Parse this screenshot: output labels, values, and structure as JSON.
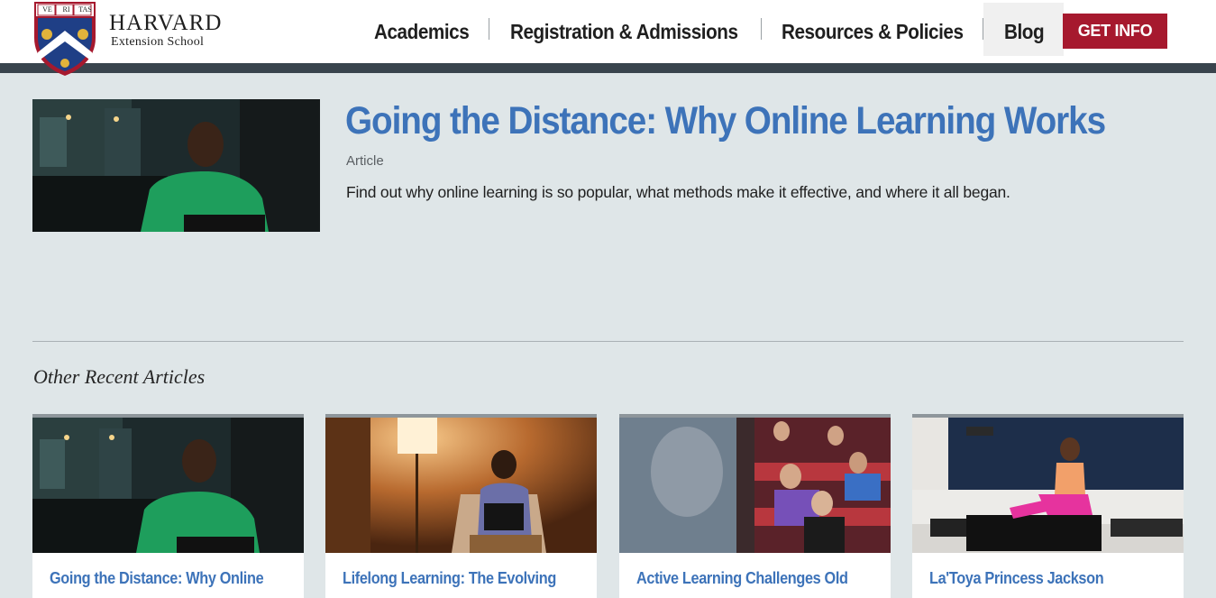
{
  "header": {
    "logo_line1": "HARVARD",
    "logo_line2": "Extension School",
    "logo_motto": [
      "VE",
      "RI",
      "TAS"
    ],
    "nav": [
      {
        "label": "Academics"
      },
      {
        "label": "Registration & Admissions"
      },
      {
        "label": "Resources & Policies"
      },
      {
        "label": "Blog"
      }
    ],
    "cta_label": "GET INFO",
    "colors": {
      "crimson": "#a6192e",
      "band": "#39444d",
      "link_blue": "#3d73b9"
    }
  },
  "featured": {
    "title": "Going the Distance: Why Online Learning Works",
    "type": "Article",
    "description": "Find out why online learning is so popular, what methods make it effective, and where it all began.",
    "image": "man-green-shirt-laptop-photo"
  },
  "recent": {
    "heading": "Other Recent Articles",
    "cards": [
      {
        "title": "Going the Distance: Why Online",
        "image": "man-green-shirt-laptop-photo"
      },
      {
        "title": "Lifelong Learning: The Evolving",
        "image": "woman-reading-lamp-photo"
      },
      {
        "title": "Active Learning Challenges Old",
        "image": "lecture-hall-students-photo"
      },
      {
        "title": "La'Toya Princess Jackson",
        "image": "woman-pink-outfit-stage-photo"
      }
    ]
  }
}
